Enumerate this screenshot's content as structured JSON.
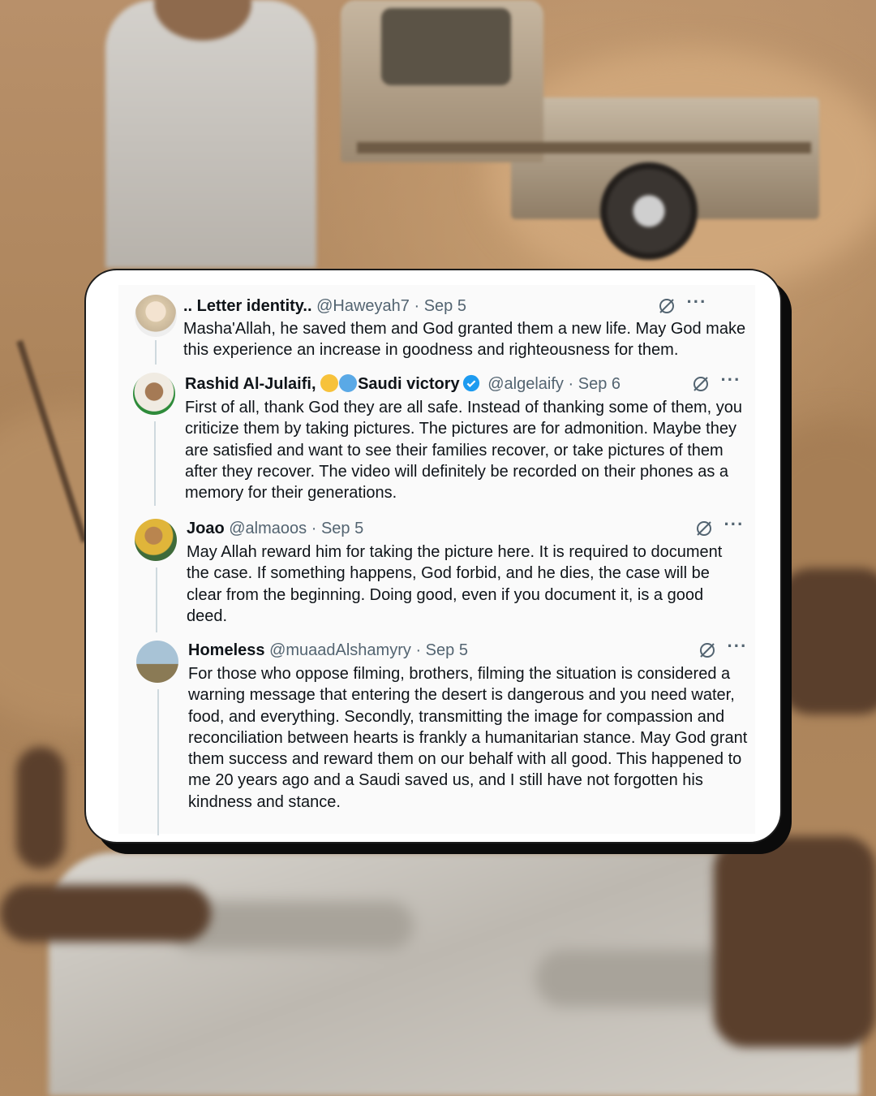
{
  "tweets": [
    {
      "name": ".. Letter identity..",
      "handle": "@Haweyah7",
      "separator": "·",
      "date": "Sep 5",
      "text": "Masha'Allah, he saved them and God granted them a new life. May God make this experience an increase in goodness and righteousness for them."
    },
    {
      "name": "Rashid Al-Julaifi,",
      "name_suffix": "Saudi victory",
      "verified": true,
      "handle": "@algelaify",
      "separator": "·",
      "date": "Sep 6",
      "text": "First of all, thank God they are all safe. Instead of thanking some of them, you criticize them by taking pictures. The pictures are for admonition. Maybe they are satisfied and want to see their families recover, or take pictures of them after they recover. The video will definitely be recorded on their phones as a memory for their generations."
    },
    {
      "name": "Joao",
      "handle": "@almaoos",
      "separator": "·",
      "date": "Sep 5",
      "text": "May Allah reward him for taking the picture here. It is required to document the case. If something happens, God forbid, and he dies, the case will be clear from the beginning. Doing good, even if you document it, is a good deed."
    },
    {
      "name": "Homeless",
      "handle": "@muaadAlshamyry",
      "separator": "·",
      "date": "Sep 5",
      "text": "For those who oppose filming, brothers, filming the situation is considered a warning message that entering the desert is dangerous and you need water, food, and everything. Secondly, transmitting the image for compassion and reconciliation between hearts is frankly a humanitarian stance. May God grant them success and reward them on our behalf with all good. This happened to me 20 years ago and a Saudi saved us, and I still have not forgotten his kindness and stance."
    }
  ],
  "icons": {
    "grok": "grok-icon",
    "more": "more-icon",
    "verified": "verified-badge-icon",
    "heart_yellow": "yellow-heart-emoji",
    "heart_blue": "blue-heart-emoji"
  },
  "colors": {
    "text": "#0f1419",
    "secondary": "#536471",
    "verified": "#1d9bf0",
    "thread": "#cfd9de"
  }
}
